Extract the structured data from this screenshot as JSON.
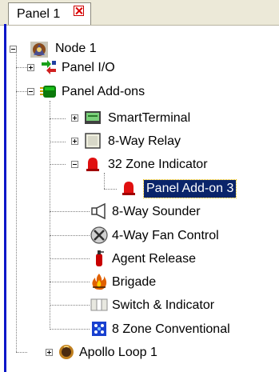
{
  "tabs": [
    {
      "label": "Panel 1",
      "close_icon": "close-icon",
      "active": true
    }
  ],
  "tree": {
    "root": {
      "label": "Node 1",
      "icon": "node-icon",
      "expanded": true
    },
    "items": [
      {
        "label": "Panel I/O",
        "icon": "io-arrows-icon",
        "expander": "plus"
      },
      {
        "label": "Panel Add-ons",
        "icon": "addon-board-icon",
        "expander": "minus"
      },
      {
        "label": "SmartTerminal",
        "icon": "terminal-icon",
        "expander": "plus"
      },
      {
        "label": "8-Way Relay",
        "icon": "relay-icon",
        "expander": "plus"
      },
      {
        "label": "32 Zone Indicator",
        "icon": "zone-indicator-icon",
        "expander": "minus"
      },
      {
        "label": "Panel Add-on 3",
        "icon": "bell-icon",
        "selected": true
      },
      {
        "label": "8-Way Sounder",
        "icon": "sounder-icon"
      },
      {
        "label": "4-Way Fan Control",
        "icon": "fan-icon"
      },
      {
        "label": "Agent Release",
        "icon": "extinguisher-icon"
      },
      {
        "label": "Brigade",
        "icon": "fire-icon"
      },
      {
        "label": "Switch & Indicator",
        "icon": "switch-icon"
      },
      {
        "label": "8 Zone Conventional",
        "icon": "conventional-zone-icon"
      },
      {
        "label": "Apollo Loop 1",
        "icon": "loop-icon",
        "expander": "plus"
      }
    ]
  },
  "colors": {
    "selection_bg": "#0a246a",
    "selection_text": "#ffffff",
    "accent_border": "#0a16c8",
    "close_red": "#d00000"
  }
}
